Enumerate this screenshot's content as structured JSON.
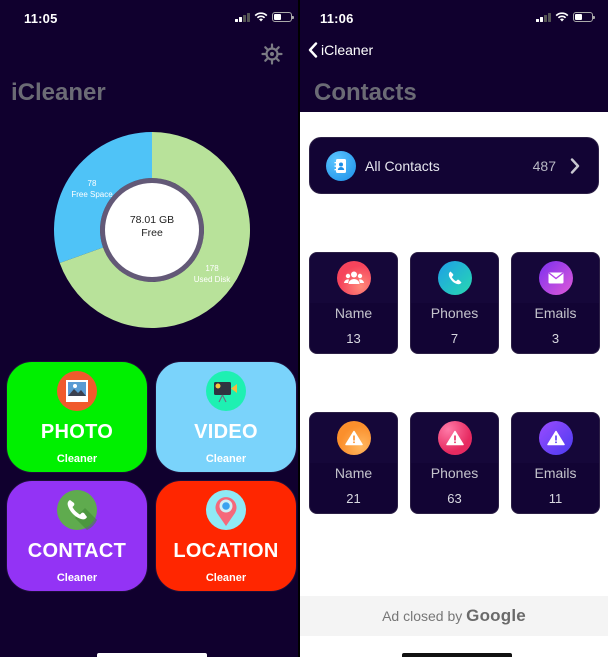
{
  "left_screen": {
    "status_bar": {
      "time": "11:05"
    },
    "settings_icon": "gear-icon",
    "title": "iCleaner",
    "storage_chart": {
      "center_value": "78.01 GB",
      "center_label": "Free",
      "colors": {
        "free": "#4fc3f7",
        "used": "#b8e29a"
      }
    },
    "tiles": [
      {
        "title": "PHOTO",
        "subtitle": "Cleaner",
        "icon": "photo-icon",
        "color": "#00f000"
      },
      {
        "title": "VIDEO",
        "subtitle": "Cleaner",
        "icon": "video-camera-icon",
        "color": "#7ad3fb"
      },
      {
        "title": "CONTACT",
        "subtitle": "Cleaner",
        "icon": "phone-icon",
        "color": "#9333f5"
      },
      {
        "title": "LOCATION",
        "subtitle": "Cleaner",
        "icon": "location-pin-icon",
        "color": "#ff2600"
      }
    ]
  },
  "right_screen": {
    "status_bar": {
      "time": "11:06"
    },
    "back_label": "iCleaner",
    "title": "Contacts",
    "all_contacts": {
      "label": "All Contacts",
      "count": "487",
      "icon": "address-book-icon"
    },
    "duplicates": [
      {
        "label": "Name",
        "value": "13",
        "icon": "people-icon",
        "color": "#f5445c"
      },
      {
        "label": "Phones",
        "value": "7",
        "icon": "phone-icon",
        "color": "#1fb8e0"
      },
      {
        "label": "Emails",
        "value": "3",
        "icon": "envelope-icon",
        "color": "#b544e8"
      }
    ],
    "incomplete": [
      {
        "label": "Name",
        "value": "21",
        "icon": "warning-icon",
        "color": "#fb9a36"
      },
      {
        "label": "Phones",
        "value": "63",
        "icon": "warning-icon",
        "color": "#ec3b72"
      },
      {
        "label": "Emails",
        "value": "11",
        "icon": "warning-icon",
        "color": "#6a3cf5"
      }
    ],
    "ad": {
      "text": "Ad closed by",
      "brand": "Google"
    }
  },
  "chart_data": {
    "type": "pie",
    "title": "",
    "center_text": [
      "78.01 GB",
      "Free"
    ],
    "slices": [
      {
        "label": "Free Space",
        "value": 78,
        "color": "#4fc3f7"
      },
      {
        "label": "Used Disk",
        "value": 178,
        "color": "#b8e29a"
      }
    ],
    "legend": "none"
  }
}
